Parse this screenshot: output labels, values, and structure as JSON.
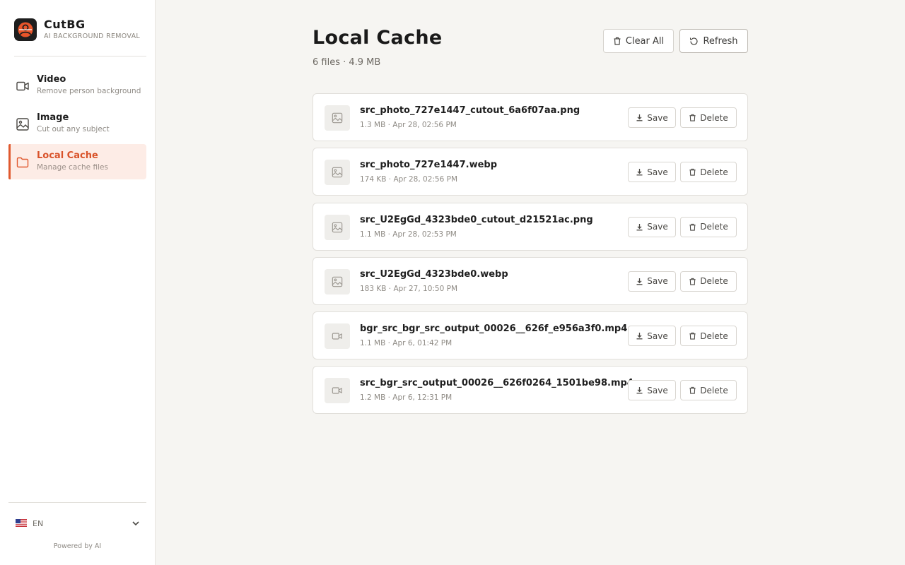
{
  "brand": {
    "name": "CutBG",
    "tagline": "AI BACKGROUND REMOVAL"
  },
  "sidebar": {
    "items": [
      {
        "title": "Video",
        "desc": "Remove person background",
        "icon": "video-icon",
        "active": false
      },
      {
        "title": "Image",
        "desc": "Cut out any subject",
        "icon": "image-icon",
        "active": false
      },
      {
        "title": "Local Cache",
        "desc": "Manage cache files",
        "icon": "folder-icon",
        "active": true
      }
    ],
    "language": "EN",
    "powered": "Powered by AI"
  },
  "main": {
    "title": "Local Cache",
    "summary": "6 files · 4.9 MB",
    "clear_all": "Clear All",
    "refresh": "Refresh",
    "save_label": "Save",
    "delete_label": "Delete",
    "files": [
      {
        "name": "src_photo_727e1447_cutout_6a6f07aa.png",
        "meta": "1.3 MB · Apr 28, 02:56 PM",
        "kind": "image"
      },
      {
        "name": "src_photo_727e1447.webp",
        "meta": "174 KB · Apr 28, 02:56 PM",
        "kind": "image"
      },
      {
        "name": "src_U2EgGd_4323bde0_cutout_d21521ac.png",
        "meta": "1.1 MB · Apr 28, 02:53 PM",
        "kind": "image"
      },
      {
        "name": "src_U2EgGd_4323bde0.webp",
        "meta": "183 KB · Apr 27, 10:50 PM",
        "kind": "image"
      },
      {
        "name": "bgr_src_bgr_src_output_00026__626f_e956a3f0.mp4",
        "meta": "1.1 MB · Apr 6, 01:42 PM",
        "kind": "video"
      },
      {
        "name": "src_bgr_src_output_00026__626f0264_1501be98.mp4",
        "meta": "1.2 MB · Apr 6, 12:31 PM",
        "kind": "video"
      }
    ]
  },
  "colors": {
    "accent": "#e0592f",
    "background": "#f6f5f2",
    "sidebar": "#ffffff"
  }
}
